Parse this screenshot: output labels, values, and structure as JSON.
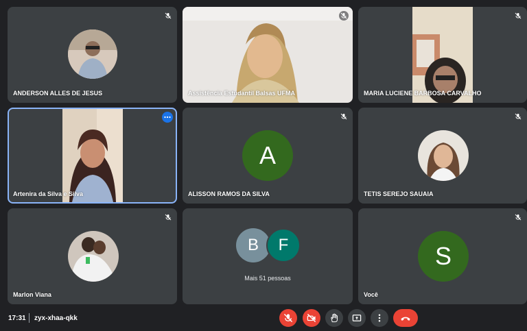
{
  "participants": [
    {
      "name": "ANDERSON ALLES DE JESUS",
      "muted": true
    },
    {
      "name": "Assistência Estudantil Balsas UFMA",
      "muted": true
    },
    {
      "name": "MARIA LUCIENE BARBOSA CARVALHO",
      "muted": true
    },
    {
      "name": "Artenira da Silva e Silva",
      "muted": false
    },
    {
      "name": "ALISSON RAMOS DA SILVA",
      "initial": "A",
      "muted": true
    },
    {
      "name": "TETIS SEREJO SAUAIA",
      "muted": true
    },
    {
      "name": "Marlon Viana",
      "muted": true
    },
    {
      "name": "Você",
      "initial": "S",
      "muted": true
    }
  ],
  "others": {
    "initials": [
      "B",
      "F"
    ],
    "label": "Mais 51 pessoas"
  },
  "footer": {
    "time": "17:31",
    "meeting_code": "zyx-xhaa-qkk"
  },
  "colors": {
    "tile": "#3c4043",
    "background": "#202124",
    "red": "#ea4335",
    "active_border": "#8ab4f8",
    "avatar_a": "#33691e",
    "avatar_s": "#33691e",
    "avatar_b": "#78909c",
    "avatar_f": "#00796b"
  },
  "icons": {
    "mic_off": "mic-off-icon",
    "cam_off": "camera-off-icon",
    "hand": "hand-icon",
    "present": "present-icon",
    "more": "more-options-icon",
    "leave": "leave-call-icon"
  }
}
